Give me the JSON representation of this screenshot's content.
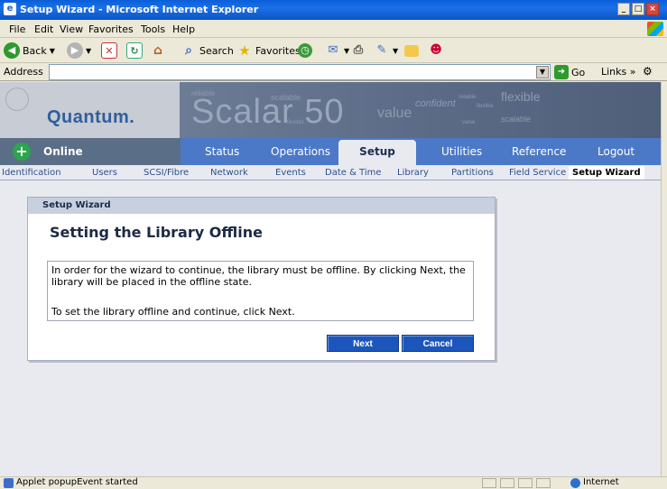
{
  "window": {
    "title": "Setup Wizard - Microsoft Internet Explorer",
    "buttons": {
      "minimize": "_",
      "maximize": "□",
      "close": "×"
    }
  },
  "menubar": {
    "items": [
      "File",
      "Edit",
      "View",
      "Favorites",
      "Tools",
      "Help"
    ]
  },
  "toolbar": {
    "back": "Back",
    "search": "Search",
    "favorites": "Favorites"
  },
  "addressbar": {
    "label": "Address",
    "value": "",
    "go": "Go",
    "links": "Links »"
  },
  "banner": {
    "brand": "Quantum.",
    "product": "Scalar 50",
    "words": [
      "reliable",
      "scalable",
      "flexible",
      "value",
      "confident",
      "flexible",
      "scalable",
      "reliable",
      "flexible",
      "value"
    ]
  },
  "navbar": {
    "status": "Online",
    "tabs": [
      "Status",
      "Operations",
      "Setup",
      "Utilities",
      "Reference",
      "Logout"
    ],
    "active": "Setup"
  },
  "subnav": {
    "tabs": [
      "Identification",
      "Users",
      "SCSI/Fibre",
      "Network",
      "Events",
      "Date & Time",
      "Library",
      "Partitions",
      "Field Service",
      "Setup Wizard"
    ],
    "active": "Setup Wizard"
  },
  "wizard": {
    "header": "Setup Wizard",
    "title": "Setting the Library Offline",
    "message1": "In order for the wizard to continue, the library must be offline. By clicking Next, the library will be placed in the offline state.",
    "message2": "To set the library offline and continue, click Next.",
    "next_label": "Next",
    "cancel_label": "Cancel"
  },
  "statusbar": {
    "text": "Applet popupEvent started",
    "zone": "Internet"
  },
  "colors": {
    "titlebar": "#0b55c4",
    "nav": "#4c78c8",
    "brand": "#2f5f9c",
    "button": "#1c56bd"
  }
}
